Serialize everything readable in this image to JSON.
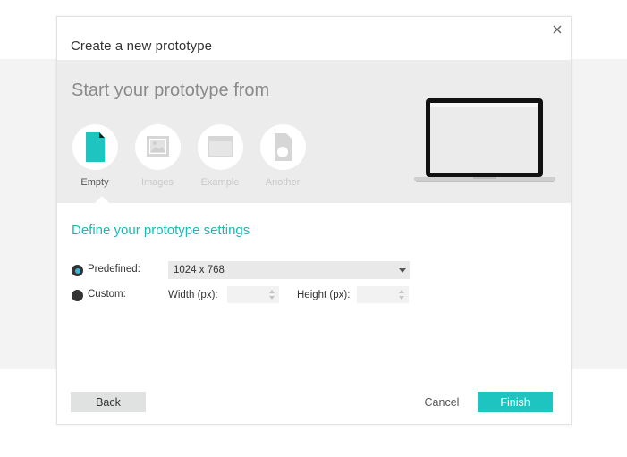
{
  "dialog": {
    "title": "Create a new prototype"
  },
  "template_panel": {
    "heading": "Start your prototype from",
    "options": [
      {
        "label": "Empty",
        "icon": "document-icon",
        "active": true
      },
      {
        "label": "Images",
        "icon": "image-icon",
        "active": false
      },
      {
        "label": "Example",
        "icon": "browser-window-icon",
        "active": false
      },
      {
        "label": "Another",
        "icon": "document-circle-icon",
        "active": false
      }
    ]
  },
  "settings": {
    "heading": "Define your prototype settings",
    "predefined_label": "Predefined:",
    "predefined_value": "1024 x 768",
    "predefined_selected": true,
    "custom_label": "Custom:",
    "width_label": "Width (px):",
    "width_value": "",
    "height_label": "Height (px):",
    "height_value": ""
  },
  "footer": {
    "back_label": "Back",
    "cancel_label": "Cancel",
    "finish_label": "Finish"
  },
  "colors": {
    "accent": "#1ec4bf",
    "heading_teal": "#1bb8b4",
    "radio_selected": "#3ab5d6",
    "panel_bg": "#ececec"
  }
}
